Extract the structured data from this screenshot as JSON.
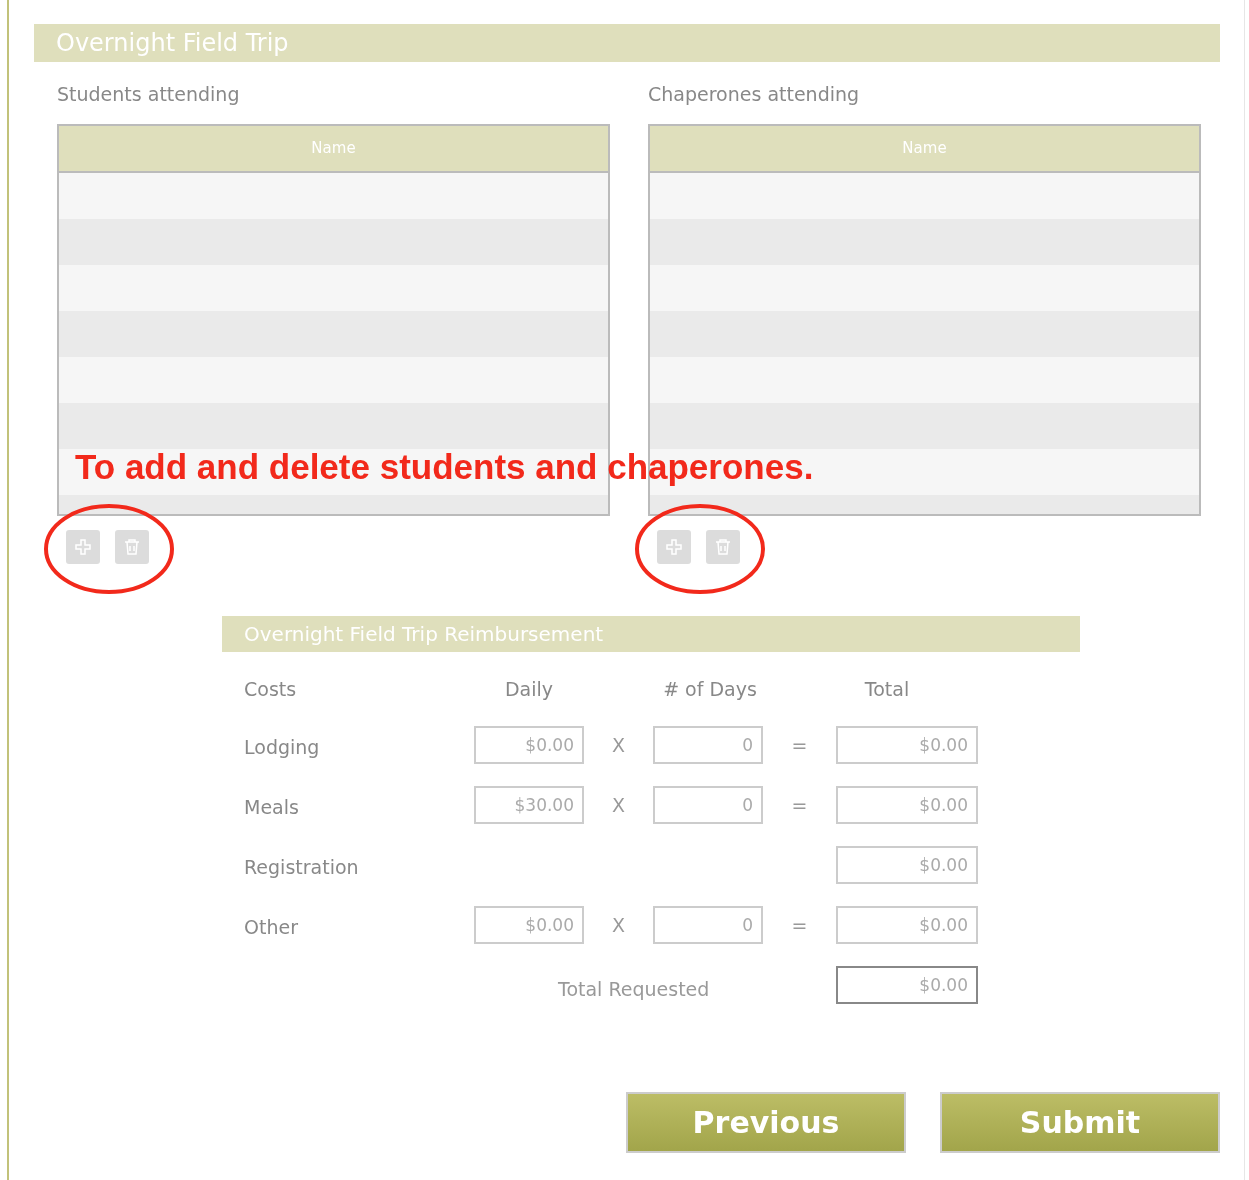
{
  "section_title": "Overnight Field Trip",
  "lists": [
    {
      "label": "Students attending",
      "column": "Name",
      "add_disabled": true,
      "delete_disabled": true,
      "highlighted": true
    },
    {
      "label": "Chaperones attending",
      "column": "Name",
      "add_disabled": true,
      "delete_disabled": true,
      "highlighted": true
    }
  ],
  "annotation": "To add and delete students and chaperones.",
  "reimbursement": {
    "title": "Overnight Field Trip Reimbursement",
    "headers": [
      "Costs",
      "Daily",
      "# of Days",
      "Total"
    ],
    "rows": [
      {
        "kind": "product",
        "label": "Lodging",
        "daily": "$0.00",
        "operator": "X",
        "days": "0",
        "equals": "=",
        "total": "$0.00"
      },
      {
        "kind": "product",
        "label": "Meals",
        "daily": "$30.00",
        "operator": "X",
        "days": "0",
        "equals": "=",
        "total": "$0.00"
      },
      {
        "kind": "flat",
        "label": "Registration",
        "total": "$0.00"
      },
      {
        "kind": "product",
        "label": "Other",
        "daily": "$0.00",
        "operator": "X",
        "days": "0",
        "equals": "=",
        "total": "$0.00"
      }
    ],
    "total_label": "Total Requested",
    "total_value": "$0.00"
  },
  "buttons": [
    "Previous",
    "Submit"
  ]
}
